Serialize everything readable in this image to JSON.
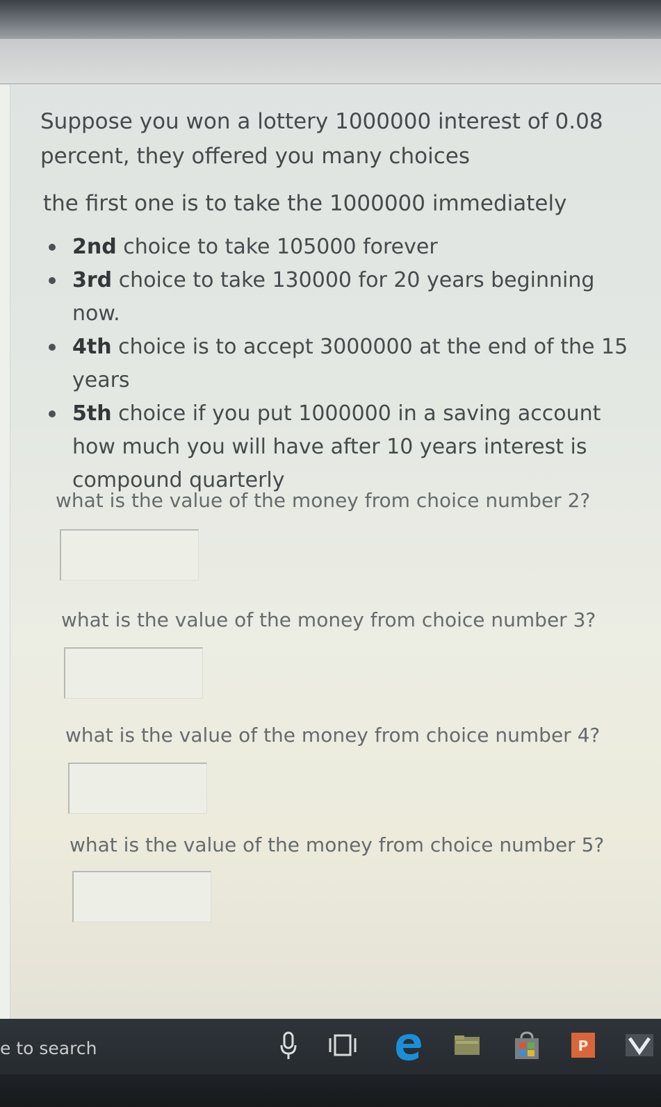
{
  "problem": {
    "intro_line1": "Suppose you won a lottery  1000000 interest of 0.08",
    "intro_line2": "percent, they offered you many  choices",
    "first_choice": "the first one is to take the 1000000 immediately",
    "choices": [
      {
        "ordinal": "2nd",
        "text": " choice to take 105000 forever"
      },
      {
        "ordinal": "3rd",
        "text": " choice to take 130000 for 20 years beginning now."
      },
      {
        "ordinal": "4th",
        "text": " choice is to accept 3000000 at the end of the 15 years"
      },
      {
        "ordinal": "5th",
        "text": " choice  if you put 1000000 in a saving account how much you will have after 10 years interest is compound quarterly"
      }
    ]
  },
  "questions": [
    {
      "label": "what is the value of the money from choice number 2?",
      "value": ""
    },
    {
      "label": "what is the value of the money from choice number 3?",
      "value": ""
    },
    {
      "label": "what is the value of the money from choice number 4?",
      "value": ""
    },
    {
      "label": "what is the value of the money from choice number 5?",
      "value": ""
    }
  ],
  "taskbar": {
    "search_text": "e to search",
    "icons": [
      "microphone-icon",
      "task-view-icon",
      "edge-browser-icon",
      "file-explorer-icon",
      "store-icon",
      "powerpoint-icon",
      "app-icon"
    ]
  },
  "colors": {
    "text": "#454a4c",
    "question_text": "#666b6b",
    "taskbar": "#1f2328",
    "edge_blue": "#1a8fd8",
    "powerpoint_orange": "#d8663a"
  }
}
